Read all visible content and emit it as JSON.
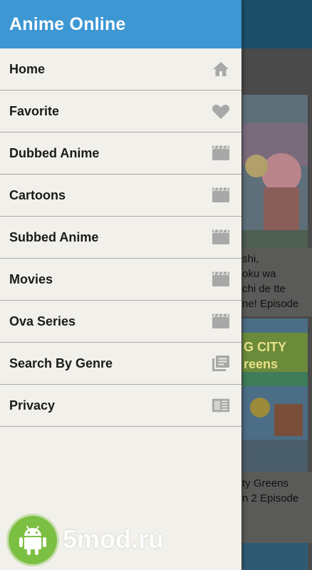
{
  "drawer": {
    "title": "Anime Online",
    "items": [
      {
        "label": "Home",
        "icon": "home-icon"
      },
      {
        "label": "Favorite",
        "icon": "heart-icon"
      },
      {
        "label": "Dubbed Anime",
        "icon": "clapperboard-icon"
      },
      {
        "label": "Cartoons",
        "icon": "clapperboard-icon"
      },
      {
        "label": "Subbed Anime",
        "icon": "clapperboard-icon"
      },
      {
        "label": "Movies",
        "icon": "clapperboard-icon"
      },
      {
        "label": "Ova Series",
        "icon": "clapperboard-icon"
      },
      {
        "label": "Search By Genre",
        "icon": "library-icon"
      },
      {
        "label": "Privacy",
        "icon": "article-icon"
      }
    ]
  },
  "background": {
    "card1_text": "shi,\noku wa\nchi de tte\nne! Episode",
    "card2_art_caption": "G CITY\nreens",
    "card2_text": "ty Greens\nn 2 Episode"
  },
  "watermark": {
    "text": "5mod.ru"
  },
  "colors": {
    "header": "#3d97d3",
    "drawer_bg": "#f2f0ea",
    "icon_gray": "#a8a8a8",
    "watermark_green": "#7cc043"
  }
}
